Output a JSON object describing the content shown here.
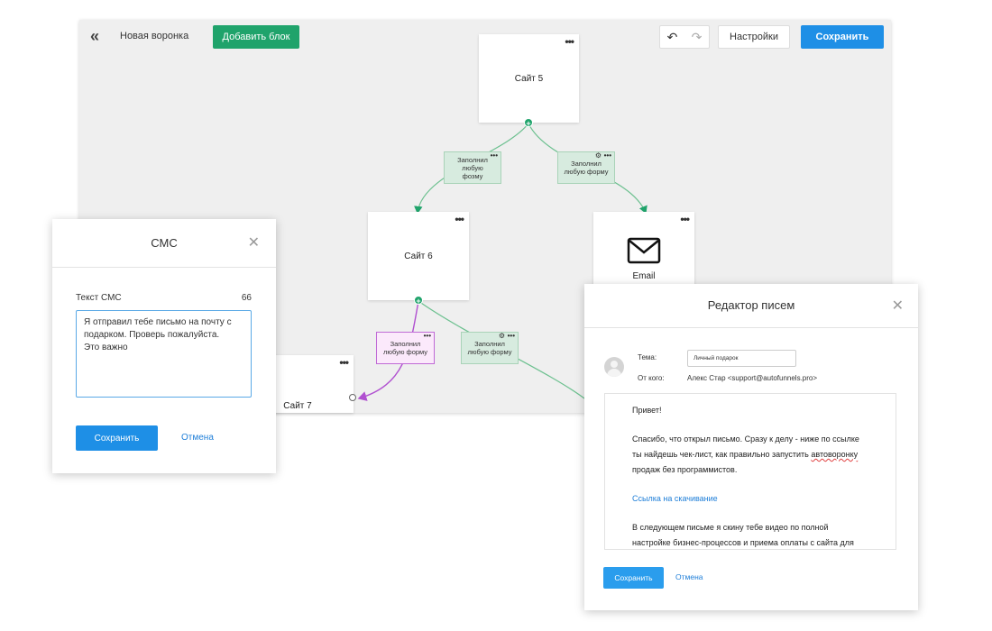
{
  "builder": {
    "back_icon": "«",
    "funnel_title": "Новая воронка",
    "add_block_label": "Добавить блок",
    "undo_icon": "↶",
    "redo_icon": "↷",
    "settings_label": "Настройки",
    "save_label": "Сохранить",
    "nodes": {
      "site5": "Сайт 5",
      "site6": "Сайт 6",
      "site7": "Сайт 7",
      "email": "Email"
    },
    "node_menu": "•••",
    "port_plus": "+",
    "conditions": {
      "c1": "Заполнил любую фозму",
      "c2": "Заполнил любую форму",
      "c3": "Заполнил любую форму",
      "c4": "Заполнил любую форму"
    },
    "gear_icon": "⚙",
    "colors": {
      "green": "#1fa36b",
      "blue": "#1e8fe6",
      "purple": "#b04fd0",
      "link_green": "#6cc08f"
    }
  },
  "sms_modal": {
    "title": "СМС",
    "close_icon": "✕",
    "text_label": "Текст СМС",
    "char_count": "66",
    "text_value": "Я отправил тебе письмо на почту с подарком. Проверь пожалуйста.\nЭто важно",
    "save_label": "Сохранить",
    "cancel_label": "Отмена"
  },
  "email_modal": {
    "title": "Редактор писем",
    "close_icon": "✕",
    "topic_label": "Тема:",
    "topic_value": "Личный подарок",
    "from_label": "От кого:",
    "from_value": "Алекс Стар <support@autofunnels.pro>",
    "body": {
      "p1": "Привет!",
      "p2a": "Спасибо, что открыл письмо. Сразу к делу - ниже по ссылке ты найдешь чек-лист, как правильно запустить ",
      "p2b": "автоворонку",
      "p2c": " продаж без программистов.",
      "link": "Ссылка на скачивание",
      "p3": "В следующем письме я скину тебе видео по полной настройке бизнес-процессов и приема оплаты с сайта для"
    },
    "save_label": "Сохранить",
    "cancel_label": "Отмена"
  }
}
